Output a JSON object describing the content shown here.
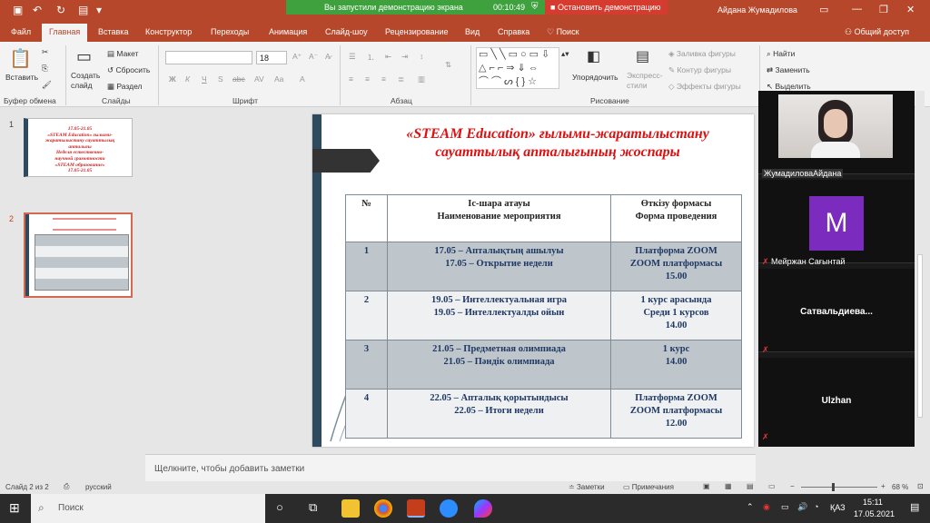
{
  "titlebar": {
    "user": "Айдана Жумадилова",
    "share_text": "Вы запустили демонстрацию экрана",
    "share_time": "00:10:49",
    "stop_label": "Остановить демонстрацию"
  },
  "tabs": [
    "Файл",
    "Главная",
    "Вставка",
    "Конструктор",
    "Переходы",
    "Анимация",
    "Слайд-шоу",
    "Рецензирование",
    "Вид",
    "Справка",
    "Поиск"
  ],
  "share_btn": "Общий доступ",
  "ribbon": {
    "paste": "Вставить",
    "clipboard_group": "Буфер обмена",
    "create_slide": "Создать слайд",
    "layout": "Макет",
    "reset": "Сбросить",
    "section": "Раздел",
    "slides_group": "Слайды",
    "font_size": "18",
    "font_group": "Шрифт",
    "para_group": "Абзац",
    "arrange": "Упорядочить",
    "express": "Экспресс-стили",
    "fill": "Заливка фигуры",
    "outline": "Контур фигуры",
    "effects": "Эффекты фигуры",
    "drawing_group": "Рисование",
    "find": "Найти",
    "replace": "Заменить",
    "select": "Выделить"
  },
  "thumbs": [
    {
      "num": "1",
      "lines": [
        "17.05-21.05",
        "«STEAM Education» ғылыми-",
        "жаратылыстану сауаттылық",
        "апталығы",
        "Неделя естественно-",
        "научной грамотности",
        "«STEAM образование»",
        "17.05-21.05"
      ]
    },
    {
      "num": "2"
    }
  ],
  "slide": {
    "title": "«STEAM Education» ғылыми-жаратылыстану сауаттылық апталығының жоспары",
    "header": {
      "num": "№",
      "event": "Іс-шара атауы\nНаименование мероприятия",
      "form": "Өткізу формасы\nФорма проведения"
    },
    "rows": [
      {
        "num": "1",
        "event": "17.05 – Апталықтың ашылуы\n17.05 – Открытие недели",
        "form": "Платформа ZOOM\nZOOM платформасы\n15.00"
      },
      {
        "num": "2",
        "event": "19.05 – Интеллектуальная игра\n19.05 – Интеллектуалды ойын",
        "form": "1 курс арасында\nСреди 1 курсов\n14.00"
      },
      {
        "num": "3",
        "event": "21.05 – Предметная олимпиада\n21.05 – Пәндік олимпиада",
        "form": "1 курс\n14.00"
      },
      {
        "num": "4",
        "event": "22.05 – Апталық қорытындысы\n22.05 – Итоги недели",
        "form": "Платформа ZOOM\nZOOM платформасы\n12.00"
      }
    ]
  },
  "notes_placeholder": "Щелкните, чтобы добавить заметки",
  "video": [
    {
      "name": "ЖумадиловаАйдана"
    },
    {
      "name": "Мейржан Сағынтай",
      "avatar": "M"
    },
    {
      "name": "Сатвальдиева..."
    },
    {
      "name": "Ulzhan"
    }
  ],
  "status": {
    "slide": "Слайд 2 из 2",
    "lang": "русский",
    "notes": "Заметки",
    "comments": "Примечания",
    "zoom": "68 %"
  },
  "taskbar": {
    "search": "Поиск",
    "lang": "ҚАЗ",
    "time": "15:11",
    "date": "17.05.2021"
  }
}
